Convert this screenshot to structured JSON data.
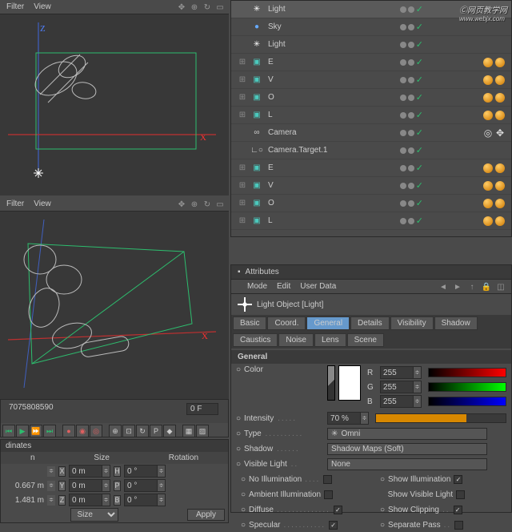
{
  "viewport_menu": {
    "filter": "Filter",
    "view": "View"
  },
  "axes": {
    "x": "X",
    "z": "Z"
  },
  "timeline": {
    "ticks": [
      "70",
      "75",
      "80",
      "85",
      "90"
    ],
    "frame": "0 F"
  },
  "obj_rows": [
    {
      "expand": "",
      "icon": "light",
      "name": "Light",
      "sel": true,
      "tags": []
    },
    {
      "expand": "",
      "icon": "sky",
      "name": "Sky",
      "tags": []
    },
    {
      "expand": "",
      "icon": "light",
      "name": "Light",
      "tags": []
    },
    {
      "expand": "+",
      "icon": "cube",
      "name": "E",
      "tags": [
        "ball",
        "ball"
      ]
    },
    {
      "expand": "+",
      "icon": "cube",
      "name": "V",
      "tags": [
        "ball",
        "ball"
      ]
    },
    {
      "expand": "+",
      "icon": "cube",
      "name": "O",
      "tags": [
        "ball",
        "ball"
      ]
    },
    {
      "expand": "+",
      "icon": "cube",
      "name": "L",
      "tags": [
        "ball",
        "ball"
      ]
    },
    {
      "expand": "",
      "icon": "camera",
      "name": "Camera",
      "tags": [
        "target",
        "cross"
      ]
    },
    {
      "expand": "",
      "icon": "target",
      "name": "Camera.Target.1",
      "tags": []
    },
    {
      "expand": "+",
      "icon": "cube",
      "name": "E",
      "tags": [
        "ball",
        "ball"
      ]
    },
    {
      "expand": "+",
      "icon": "cube",
      "name": "V",
      "tags": [
        "ball",
        "ball"
      ]
    },
    {
      "expand": "+",
      "icon": "cube",
      "name": "O",
      "tags": [
        "ball",
        "ball"
      ]
    },
    {
      "expand": "+",
      "icon": "cube",
      "name": "L",
      "tags": [
        "ball",
        "ball"
      ]
    }
  ],
  "attributes": {
    "title": "Attributes",
    "menu": {
      "mode": "Mode",
      "edit": "Edit",
      "user_data": "User Data"
    },
    "head": "Light Object [Light]",
    "tabs1": [
      "Basic",
      "Coord.",
      "General",
      "Details",
      "Visibility",
      "Shadow"
    ],
    "tabs2": [
      "Caustics",
      "Noise",
      "Lens",
      "Scene"
    ],
    "active_tab": "General",
    "section": "General",
    "color_label": "Color",
    "rgb": {
      "r": "255",
      "g": "255",
      "b": "255"
    },
    "intensity": {
      "label": "Intensity",
      "value": "70 %"
    },
    "type": {
      "label": "Type",
      "value": "Omni"
    },
    "shadow": {
      "label": "Shadow",
      "value": "Shadow Maps (Soft)"
    },
    "visible_light": {
      "label": "Visible Light",
      "value": "None"
    },
    "checks": {
      "no_illum": "No Illumination",
      "show_illum": "Show Illumination",
      "ambient": "Ambient Illumination",
      "show_vis": "Show Visible Light",
      "diffuse": "Diffuse",
      "show_clip": "Show Clipping",
      "specular": "Specular",
      "sep_pass": "Separate Pass"
    }
  },
  "coords": {
    "title": "dinates",
    "cols": [
      "n",
      "Size",
      "Rotation"
    ],
    "rows": [
      {
        "v1": "",
        "x": "X",
        "f1": "0 m",
        "a": "H",
        "f2": "0 °"
      },
      {
        "v1": "0.667 m",
        "x": "Y",
        "f1": "0 m",
        "a": "P",
        "f2": "0 °"
      },
      {
        "v1": "1.481 m",
        "x": "Z",
        "f1": "0 m",
        "a": "B",
        "f2": "0 °"
      }
    ],
    "btns": {
      "size": "Size",
      "apply": "Apply"
    }
  },
  "watermark": {
    "main": "网页教学网",
    "sub": "www.webjx.com"
  }
}
